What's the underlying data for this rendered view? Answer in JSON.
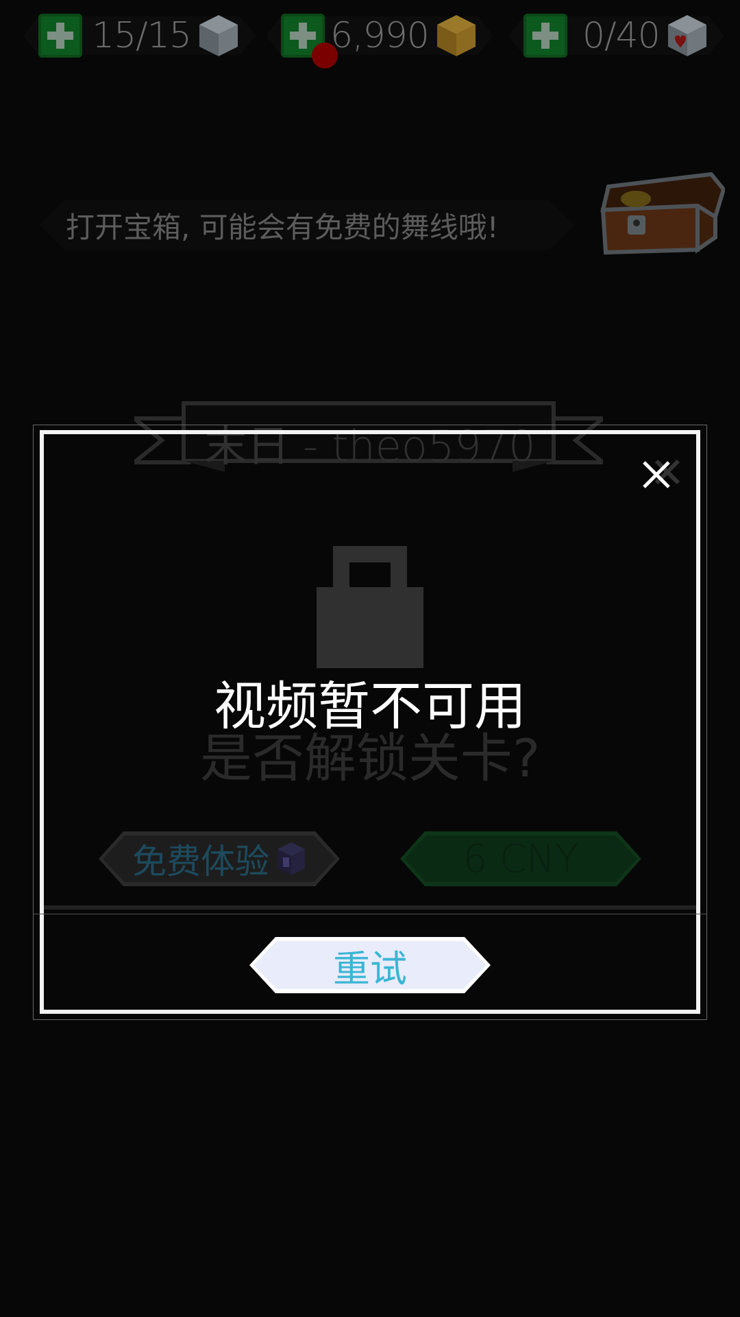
{
  "resources": [
    {
      "value": "15/15",
      "plus_icon": "plus-icon",
      "icon": "silver-cube-icon"
    },
    {
      "value": "6,990",
      "plus_icon": "plus-icon",
      "icon": "gold-cube-icon"
    },
    {
      "value": "0/40",
      "plus_icon": "plus-icon",
      "icon": "heart-cube-icon"
    }
  ],
  "hint": {
    "text": "打开宝箱, 可能会有免费的舞线哦!",
    "icon": "treasure-chest-icon"
  },
  "level": {
    "title": "末日 - theo5970"
  },
  "dialog": {
    "title": "视频暂不可用",
    "subtitle": "是否解锁关卡?",
    "free_trial_label": "免费体验",
    "price_label": "6 CNY",
    "retry_label": "重试",
    "close_icon": "close-icon",
    "lock_icon": "lock-icon"
  },
  "colors": {
    "background": "#070707",
    "plus_green": "#0d5a1e",
    "dialog_border": "#f2f2f2",
    "retry_text": "#3ab6d4",
    "retry_bg": "#e9ecfb"
  }
}
